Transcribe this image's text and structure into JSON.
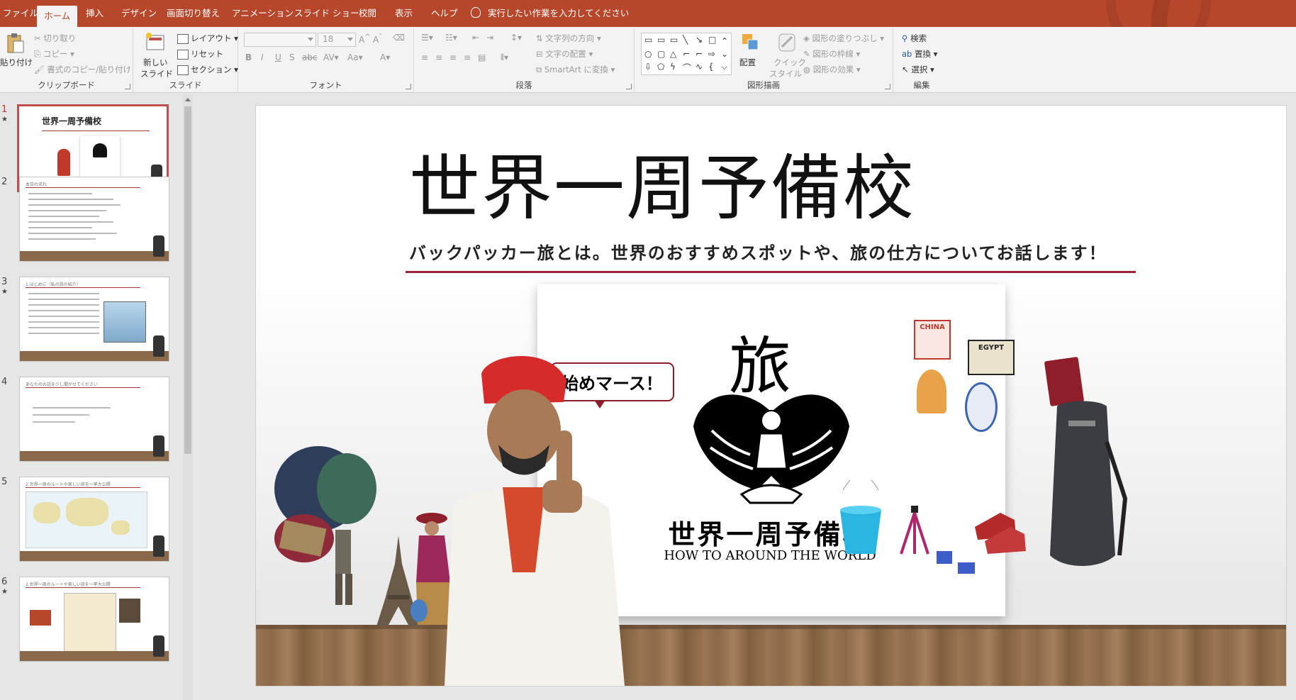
{
  "menu": {
    "tabs": [
      "ファイル",
      "ホーム",
      "挿入",
      "デザイン",
      "画面切り替え",
      "アニメーション",
      "スライド ショー",
      "校閲",
      "表示",
      "ヘルプ"
    ],
    "active_tab": "ホーム",
    "tell_me": "実行したい作業を入力してください"
  },
  "ribbon": {
    "clipboard": {
      "label": "クリップボード",
      "paste": "貼り付け",
      "cut": "切り取り",
      "copy": "コピー",
      "format_painter": "書式のコピー/貼り付け"
    },
    "slides": {
      "label": "スライド",
      "new_slide_1": "新しい",
      "new_slide_2": "スライド",
      "layout": "レイアウト",
      "reset": "リセット",
      "section": "セクション"
    },
    "font": {
      "label": "フォント",
      "size": "18"
    },
    "paragraph": {
      "label": "段落",
      "text_direction": "文字列の方向",
      "align_text": "文字の配置",
      "smartart": "SmartArt に変換"
    },
    "drawing": {
      "label": "図形描画",
      "arrange": "配置",
      "quick_styles_1": "クイック",
      "quick_styles_2": "スタイル",
      "shape_fill": "図形の塗りつぶし",
      "shape_outline": "図形の枠線",
      "shape_effects": "図形の効果"
    },
    "editing": {
      "label": "編集",
      "find": "検索",
      "replace": "置換",
      "select": "選択"
    }
  },
  "thumbnails": [
    {
      "num": "1",
      "star": true,
      "title": "世界一周予備校"
    },
    {
      "num": "2",
      "star": false,
      "title": "本日の流れ"
    },
    {
      "num": "3",
      "star": true,
      "title": "1.はじめに（私の旅の紹介）"
    },
    {
      "num": "4",
      "star": false,
      "title": "あなたのお話を少し聞かせてください"
    },
    {
      "num": "5",
      "star": false,
      "title": "2.世界一周のルートや楽しい旅を一挙大公開"
    },
    {
      "num": "6",
      "star": true,
      "title": "2.世界一周のルートや楽しい旅を一挙大公開"
    }
  ],
  "slide": {
    "title": "世界一周予備校",
    "subtitle": "バックパッカー旅とは。世界のおすすめスポットや、旅の仕方についてお話します！",
    "logo_kanji": "旅",
    "logo_name": "世界一周予備校",
    "logo_sub": "HOW TO AROUND THE WORLD",
    "speech_bubble": "始めマース！",
    "stickers": [
      "CHINA",
      "EGYPT"
    ]
  },
  "colors": {
    "accent": "#b7472a",
    "title_rule": "#9b2335"
  }
}
